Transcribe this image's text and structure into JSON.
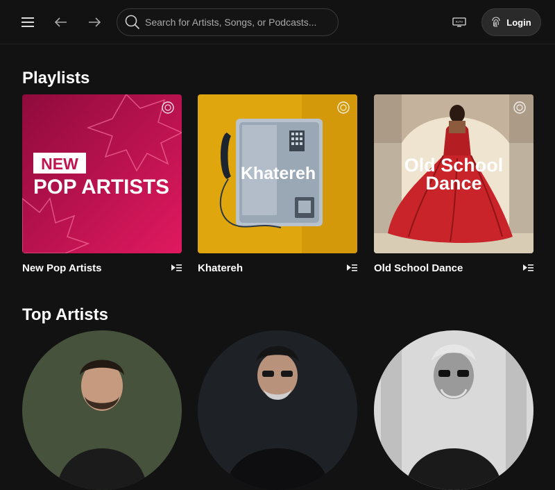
{
  "topbar": {
    "menu_icon": "hamburger-menu-icon",
    "back_icon": "arrow-left-icon",
    "forward_icon": "arrow-right-icon",
    "search_placeholder": "Search for Artists, Songs, or Podcasts...",
    "search_value": "",
    "tv_icon": "tv-icon",
    "tv_label": "RJTV",
    "login_icon": "fingerprint-icon",
    "login_label": "Login"
  },
  "playlists": {
    "heading": "Playlists",
    "items": [
      {
        "title": "New Pop Artists",
        "cover_badge": "NEW",
        "cover_text": "POP ARTISTS",
        "colors": [
          "#b3104d",
          "#e11d63"
        ]
      },
      {
        "title": "Khatereh",
        "cover_text": "Khatereh",
        "colors": [
          "#e0a910",
          "#c98e06"
        ]
      },
      {
        "title": "Old School Dance",
        "cover_text_line1": "Old School",
        "cover_text_line2": "Dance",
        "colors": [
          "#b51f1f",
          "#e8dcc6"
        ]
      }
    ]
  },
  "top_artists": {
    "heading": "Top Artists"
  },
  "colors": {
    "background": "#121212",
    "surface": "#2a2a2a",
    "border": "#3a3a3a",
    "text": "#ffffff",
    "muted": "#a9a9a9"
  }
}
